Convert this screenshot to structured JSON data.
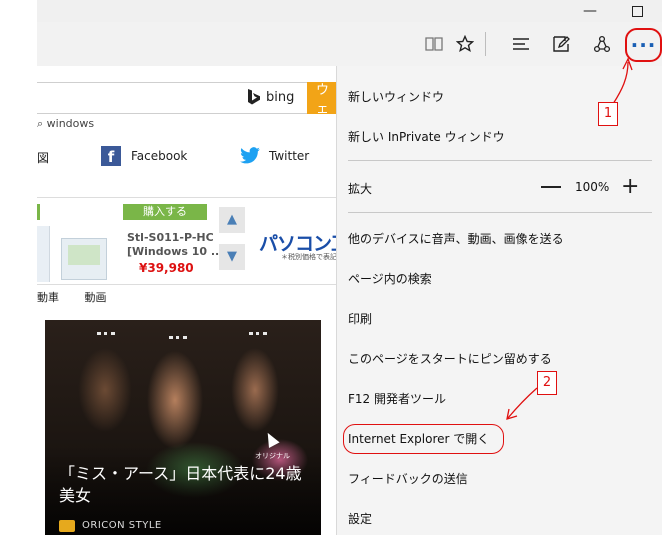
{
  "window_controls": {
    "minimize": "—",
    "close": "✕"
  },
  "toolbar": {
    "icons": [
      "reading-view-icon",
      "favorite-star-icon",
      "hub-icon",
      "web-note-icon",
      "share-icon",
      "more-icon"
    ],
    "more_label": "···"
  },
  "page": {
    "search_engine": "bing",
    "orange_tab": "ウェ",
    "search_hint": "⌕ windows",
    "social_left": "図",
    "facebook": "Facebook",
    "twitter": "Twitter",
    "ad": {
      "buy_label": "購入する",
      "sku": "Stl-S011-P-HC",
      "desc": "[Windows 10 ...",
      "price": "¥39,980",
      "brand": "パソコン工",
      "brand_note": "＊税別価格で表記"
    },
    "categories": [
      "動車",
      "動画"
    ],
    "news": {
      "title": "「ミス・アース」日本代表に24歳美女",
      "source": "ORICON STYLE",
      "watermark": "オリジナル"
    }
  },
  "menu": {
    "new_window": "新しいウィンドウ",
    "new_inprivate": "新しい InPrivate ウィンドウ",
    "zoom_label": "拡大",
    "zoom_value": "100%",
    "cast": "他のデバイスに音声、動画、画像を送る",
    "find": "ページ内の検索",
    "print": "印刷",
    "pin": "このページをスタートにピン留めする",
    "devtools": "F12 開発者ツール",
    "open_ie": "Internet Explorer で開く",
    "feedback": "フィードバックの送信",
    "settings": "設定"
  },
  "annotations": {
    "step1": "1",
    "step2": "2"
  },
  "colors": {
    "annotation_red": "#e01010",
    "accent_blue": "#1a5fb4",
    "menu_bg": "#f4f4f4",
    "toolbar_bg": "#f2f2f2"
  }
}
